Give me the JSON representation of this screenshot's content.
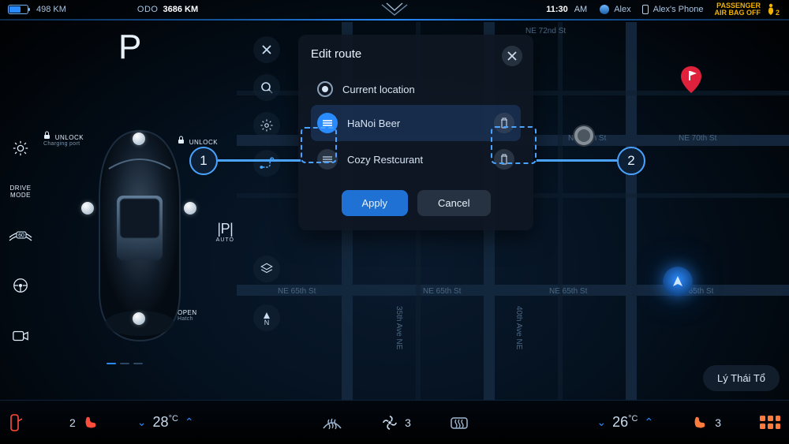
{
  "status": {
    "range": "498 KM",
    "odo_label": "ODO",
    "odo_value": "3686 KM",
    "time": "11:30",
    "ampm": "AM",
    "user": "Alex",
    "phone": "Alex's Phone",
    "airbag_l1": "PASSENGER",
    "airbag_l2": "AIR BAG OFF"
  },
  "gear": "P",
  "quickrail": {
    "drive_mode_l1": "DRIVE",
    "drive_mode_l2": "MODE",
    "wiper_badge": "60"
  },
  "vehicle": {
    "charge_title": "UNLOCK",
    "charge_sub": "Charging port",
    "unlock": "UNLOCK",
    "hatch_title": "OPEN",
    "hatch_sub": "Hatch",
    "autopark_main": "|P|",
    "autopark_sub": "AUTO"
  },
  "route_panel": {
    "title": "Edit route",
    "stops": [
      {
        "label": "Current location",
        "type": "radio"
      },
      {
        "label": "HaNoi Beer",
        "type": "item",
        "selected": true
      },
      {
        "label": "Cozy Restcurant",
        "type": "item",
        "selected": false
      }
    ],
    "apply": "Apply",
    "cancel": "Cancel"
  },
  "map": {
    "streets": {
      "ne72": "NE 72nd St",
      "ne70a": "NE 70th St",
      "ne70b": "NE 70th St",
      "ne65a": "NE 65th St",
      "ne65b": "NE 65th St",
      "ne65c": "NE 65th St",
      "ne65d": "NE 65th St",
      "av35": "35th Ave NE",
      "av40": "40th Ave NE"
    },
    "chip": "Lý Thái Tổ"
  },
  "callouts": {
    "one": "1",
    "two": "2"
  },
  "bottom": {
    "seat_left_count": "2",
    "temp_left": "28",
    "temp_unit": "°C",
    "fan_level": "3",
    "temp_right": "26",
    "seat_right_count": "3"
  }
}
